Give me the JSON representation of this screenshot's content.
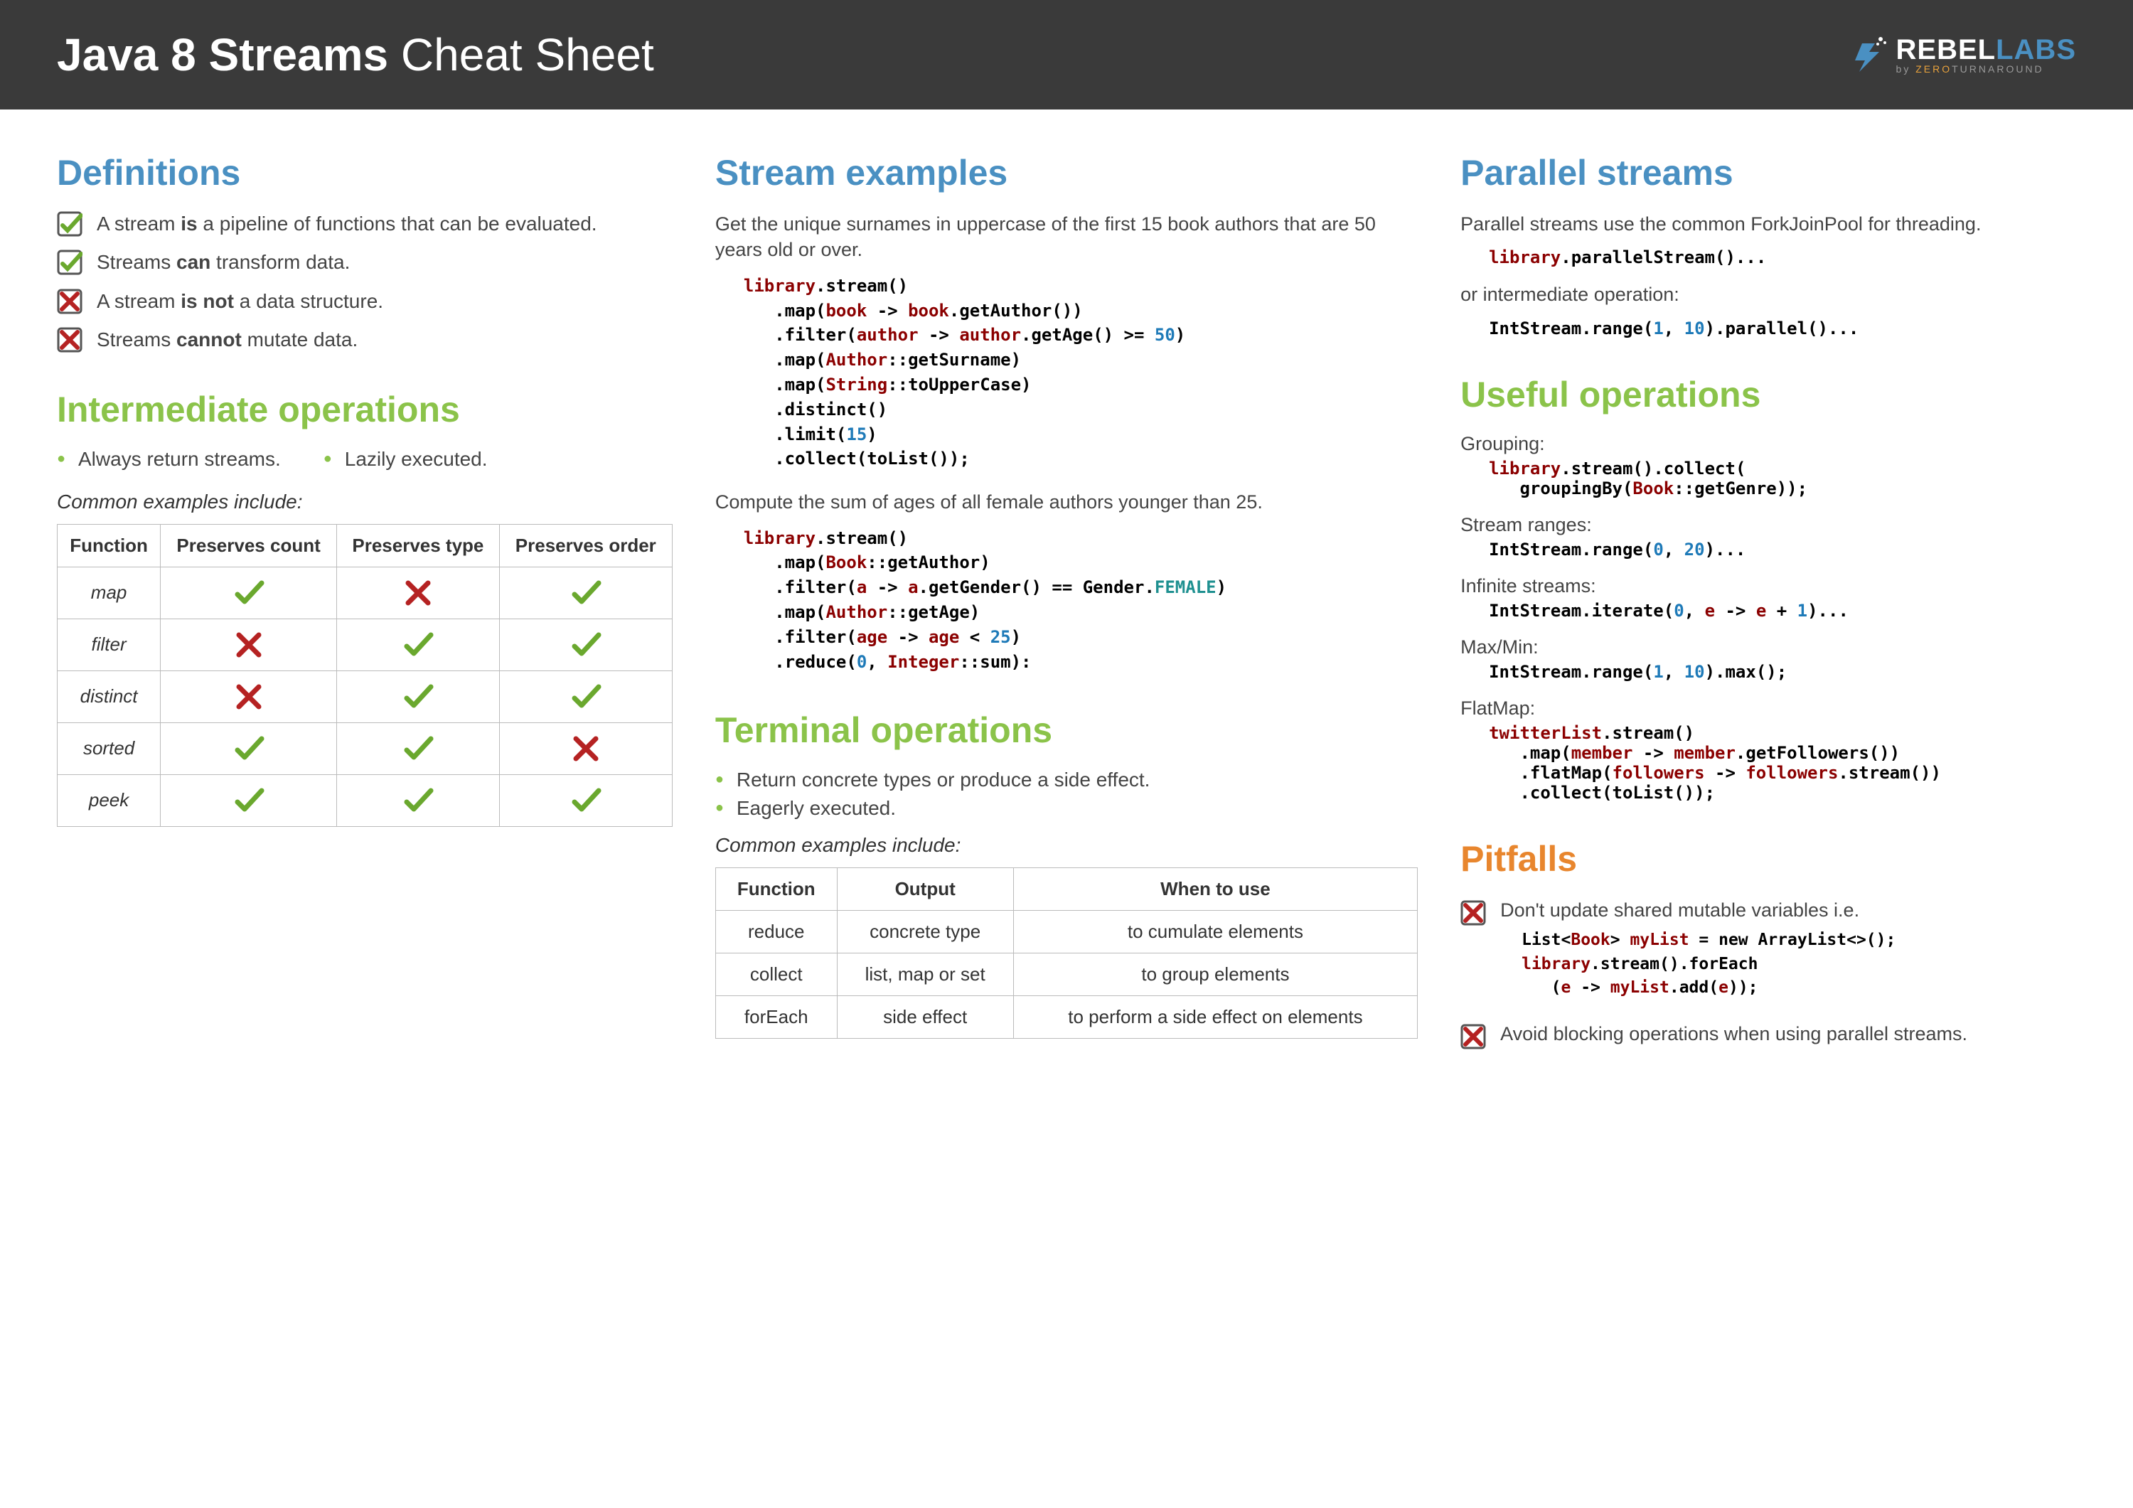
{
  "header": {
    "title_bold": "Java 8 Streams",
    "title_rest": " Cheat Sheet",
    "logo_primary_a": "REBEL",
    "logo_primary_b": "LABS",
    "logo_sub_by": "by ",
    "logo_sub_zero": "ZERO",
    "logo_sub_rest": "TURNAROUND"
  },
  "definitions": {
    "heading": "Definitions",
    "items": [
      {
        "ok": true,
        "pre": "A stream ",
        "bold": "is",
        "post": " a pipeline of functions that can be evaluated."
      },
      {
        "ok": true,
        "pre": "Streams ",
        "bold": "can",
        "post": " transform data."
      },
      {
        "ok": false,
        "pre": "A stream ",
        "bold": "is not",
        "post": " a data structure."
      },
      {
        "ok": false,
        "pre": "Streams ",
        "bold": "cannot",
        "post": " mutate data."
      }
    ]
  },
  "intermediate": {
    "heading": "Intermediate operations",
    "bullets": [
      "Always return streams.",
      "Lazily executed."
    ],
    "subhead": "Common examples include:",
    "table": {
      "headers": [
        "Function",
        "Preserves count",
        "Preserves type",
        "Preserves order"
      ],
      "rows": [
        {
          "fn": "map",
          "v": [
            true,
            false,
            true
          ]
        },
        {
          "fn": "filter",
          "v": [
            false,
            true,
            true
          ]
        },
        {
          "fn": "distinct",
          "v": [
            false,
            true,
            true
          ]
        },
        {
          "fn": "sorted",
          "v": [
            true,
            true,
            false
          ]
        },
        {
          "fn": "peek",
          "v": [
            true,
            true,
            true
          ]
        }
      ]
    }
  },
  "examples": {
    "heading": "Stream examples",
    "ex1_desc": "Get the unique surnames in uppercase of the first 15 book authors that are 50 years old or over.",
    "ex1_code": [
      {
        "t": "library",
        "c": "kw"
      },
      {
        "t": ".",
        "c": "op"
      },
      {
        "t": "stream",
        "c": "op"
      },
      {
        "t": "()",
        "c": "op"
      },
      {
        "t": "\n   ."
      },
      {
        "t": "map",
        "c": "op"
      },
      {
        "t": "("
      },
      {
        "t": "book",
        "c": "kw"
      },
      {
        "t": " -> "
      },
      {
        "t": "book",
        "c": "kw"
      },
      {
        "t": "."
      },
      {
        "t": "getAuthor",
        "c": "op"
      },
      {
        "t": "())"
      },
      {
        "t": "\n   ."
      },
      {
        "t": "filter",
        "c": "op"
      },
      {
        "t": "("
      },
      {
        "t": "author",
        "c": "kw"
      },
      {
        "t": " -> "
      },
      {
        "t": "author",
        "c": "kw"
      },
      {
        "t": "."
      },
      {
        "t": "getAge",
        "c": "op"
      },
      {
        "t": "() >= "
      },
      {
        "t": "50",
        "c": "num"
      },
      {
        "t": ")"
      },
      {
        "t": "\n   ."
      },
      {
        "t": "map",
        "c": "op"
      },
      {
        "t": "("
      },
      {
        "t": "Author",
        "c": "kw"
      },
      {
        "t": "::"
      },
      {
        "t": "getSurname",
        "c": "op"
      },
      {
        "t": ")"
      },
      {
        "t": "\n   ."
      },
      {
        "t": "map",
        "c": "op"
      },
      {
        "t": "("
      },
      {
        "t": "String",
        "c": "kw"
      },
      {
        "t": "::"
      },
      {
        "t": "toUpperCase",
        "c": "op"
      },
      {
        "t": ")"
      },
      {
        "t": "\n   ."
      },
      {
        "t": "distinct",
        "c": "op"
      },
      {
        "t": "()"
      },
      {
        "t": "\n   ."
      },
      {
        "t": "limit",
        "c": "op"
      },
      {
        "t": "("
      },
      {
        "t": "15",
        "c": "num"
      },
      {
        "t": ")"
      },
      {
        "t": "\n   ."
      },
      {
        "t": "collect",
        "c": "op"
      },
      {
        "t": "("
      },
      {
        "t": "toList",
        "c": "op"
      },
      {
        "t": "());"
      }
    ],
    "ex2_desc": "Compute the sum of ages of all female authors younger than 25.",
    "ex2_code": [
      {
        "t": "library",
        "c": "kw"
      },
      {
        "t": "."
      },
      {
        "t": "stream",
        "c": "op"
      },
      {
        "t": "()"
      },
      {
        "t": "\n   ."
      },
      {
        "t": "map",
        "c": "op"
      },
      {
        "t": "("
      },
      {
        "t": "Book",
        "c": "kw"
      },
      {
        "t": "::"
      },
      {
        "t": "getAuthor",
        "c": "op"
      },
      {
        "t": ")"
      },
      {
        "t": "\n   ."
      },
      {
        "t": "filter",
        "c": "op"
      },
      {
        "t": "("
      },
      {
        "t": "a",
        "c": "kw"
      },
      {
        "t": " -> "
      },
      {
        "t": "a",
        "c": "kw"
      },
      {
        "t": "."
      },
      {
        "t": "getGender",
        "c": "op"
      },
      {
        "t": "() == "
      },
      {
        "t": "Gender",
        "c": "op"
      },
      {
        "t": "."
      },
      {
        "t": "FEMALE",
        "c": "teal"
      },
      {
        "t": ")"
      },
      {
        "t": "\n   ."
      },
      {
        "t": "map",
        "c": "op"
      },
      {
        "t": "("
      },
      {
        "t": "Author",
        "c": "kw"
      },
      {
        "t": "::"
      },
      {
        "t": "getAge",
        "c": "op"
      },
      {
        "t": ")"
      },
      {
        "t": "\n   ."
      },
      {
        "t": "filter",
        "c": "op"
      },
      {
        "t": "("
      },
      {
        "t": "age",
        "c": "kw"
      },
      {
        "t": " -> "
      },
      {
        "t": "age",
        "c": "kw"
      },
      {
        "t": " < "
      },
      {
        "t": "25",
        "c": "num"
      },
      {
        "t": ")"
      },
      {
        "t": "\n   ."
      },
      {
        "t": "reduce",
        "c": "op"
      },
      {
        "t": "("
      },
      {
        "t": "0",
        "c": "num"
      },
      {
        "t": ", "
      },
      {
        "t": "Integer",
        "c": "kw"
      },
      {
        "t": "::"
      },
      {
        "t": "sum",
        "c": "op"
      },
      {
        "t": "):"
      }
    ]
  },
  "terminal": {
    "heading": "Terminal operations",
    "bullets": [
      "Return concrete types or produce a side effect.",
      "Eagerly executed."
    ],
    "subhead": "Common examples include:",
    "table": {
      "headers": [
        "Function",
        "Output",
        "When to use"
      ],
      "rows": [
        [
          "reduce",
          "concrete type",
          "to cumulate elements"
        ],
        [
          "collect",
          "list, map or set",
          "to group elements"
        ],
        [
          "forEach",
          "side effect",
          "to perform a side effect on elements"
        ]
      ]
    }
  },
  "parallel": {
    "heading": "Parallel streams",
    "desc1": "Parallel streams use the common ForkJoinPool for threading.",
    "code1": [
      {
        "t": "library",
        "c": "kw"
      },
      {
        "t": "."
      },
      {
        "t": "parallelStream",
        "c": "op"
      },
      {
        "t": "()..."
      }
    ],
    "desc2": "or intermediate operation:",
    "code2": [
      {
        "t": "IntStream",
        "c": "op"
      },
      {
        "t": "."
      },
      {
        "t": "range",
        "c": "op"
      },
      {
        "t": "("
      },
      {
        "t": "1",
        "c": "num"
      },
      {
        "t": ", "
      },
      {
        "t": "10",
        "c": "num"
      },
      {
        "t": ")."
      },
      {
        "t": "parallel",
        "c": "op"
      },
      {
        "t": "()..."
      }
    ]
  },
  "useful": {
    "heading": "Useful operations",
    "items": [
      {
        "label": "Grouping:",
        "code": [
          {
            "t": "library",
            "c": "kw"
          },
          {
            "t": "."
          },
          {
            "t": "stream",
            "c": "op"
          },
          {
            "t": "()."
          },
          {
            "t": "collect",
            "c": "op"
          },
          {
            "t": "(\n   "
          },
          {
            "t": "groupingBy",
            "c": "op"
          },
          {
            "t": "("
          },
          {
            "t": "Book",
            "c": "kw"
          },
          {
            "t": "::"
          },
          {
            "t": "getGenre",
            "c": "op"
          },
          {
            "t": "));"
          }
        ]
      },
      {
        "label": "Stream ranges:",
        "code": [
          {
            "t": "IntStream",
            "c": "op"
          },
          {
            "t": "."
          },
          {
            "t": "range",
            "c": "op"
          },
          {
            "t": "("
          },
          {
            "t": "0",
            "c": "num"
          },
          {
            "t": ", "
          },
          {
            "t": "20",
            "c": "num"
          },
          {
            "t": ")..."
          }
        ]
      },
      {
        "label": "Infinite streams:",
        "code": [
          {
            "t": "IntStream",
            "c": "op"
          },
          {
            "t": "."
          },
          {
            "t": "iterate",
            "c": "op"
          },
          {
            "t": "("
          },
          {
            "t": "0",
            "c": "num"
          },
          {
            "t": ", "
          },
          {
            "t": "e",
            "c": "kw"
          },
          {
            "t": " -> "
          },
          {
            "t": "e",
            "c": "kw"
          },
          {
            "t": " + "
          },
          {
            "t": "1",
            "c": "num"
          },
          {
            "t": ")..."
          }
        ]
      },
      {
        "label": "Max/Min:",
        "code": [
          {
            "t": "IntStream",
            "c": "op"
          },
          {
            "t": "."
          },
          {
            "t": "range",
            "c": "op"
          },
          {
            "t": "("
          },
          {
            "t": "1",
            "c": "num"
          },
          {
            "t": ", "
          },
          {
            "t": "10",
            "c": "num"
          },
          {
            "t": ")."
          },
          {
            "t": "max",
            "c": "op"
          },
          {
            "t": "();"
          }
        ]
      },
      {
        "label": "FlatMap:",
        "code": [
          {
            "t": "twitterList",
            "c": "kw"
          },
          {
            "t": "."
          },
          {
            "t": "stream",
            "c": "op"
          },
          {
            "t": "()\n   ."
          },
          {
            "t": "map",
            "c": "op"
          },
          {
            "t": "("
          },
          {
            "t": "member",
            "c": "kw"
          },
          {
            "t": " -> "
          },
          {
            "t": "member",
            "c": "kw"
          },
          {
            "t": "."
          },
          {
            "t": "getFollowers",
            "c": "op"
          },
          {
            "t": "())\n   ."
          },
          {
            "t": "flatMap",
            "c": "op"
          },
          {
            "t": "("
          },
          {
            "t": "followers",
            "c": "kw"
          },
          {
            "t": " -> "
          },
          {
            "t": "followers",
            "c": "kw"
          },
          {
            "t": "."
          },
          {
            "t": "stream",
            "c": "op"
          },
          {
            "t": "())\n   ."
          },
          {
            "t": "collect",
            "c": "op"
          },
          {
            "t": "("
          },
          {
            "t": "toList",
            "c": "op"
          },
          {
            "t": "());"
          }
        ]
      }
    ]
  },
  "pitfalls": {
    "heading": "Pitfalls",
    "items": [
      {
        "text": "Don't update shared mutable variables i.e.",
        "code": [
          {
            "t": "List",
            "c": "op"
          },
          {
            "t": "<"
          },
          {
            "t": "Book",
            "c": "kw"
          },
          {
            "t": "> "
          },
          {
            "t": "myList",
            "c": "kw"
          },
          {
            "t": " = "
          },
          {
            "t": "new ",
            "c": "op"
          },
          {
            "t": "ArrayList",
            "c": "op"
          },
          {
            "t": "<>();\n"
          },
          {
            "t": "library",
            "c": "kw"
          },
          {
            "t": "."
          },
          {
            "t": "stream",
            "c": "op"
          },
          {
            "t": "()."
          },
          {
            "t": "forEach",
            "c": "op"
          },
          {
            "t": "\n   ("
          },
          {
            "t": "e",
            "c": "kw"
          },
          {
            "t": " -> "
          },
          {
            "t": "myList",
            "c": "kw"
          },
          {
            "t": "."
          },
          {
            "t": "add",
            "c": "op"
          },
          {
            "t": "("
          },
          {
            "t": "e",
            "c": "kw"
          },
          {
            "t": "));"
          }
        ]
      },
      {
        "text": "Avoid blocking operations when using parallel streams.",
        "code": null
      }
    ]
  }
}
